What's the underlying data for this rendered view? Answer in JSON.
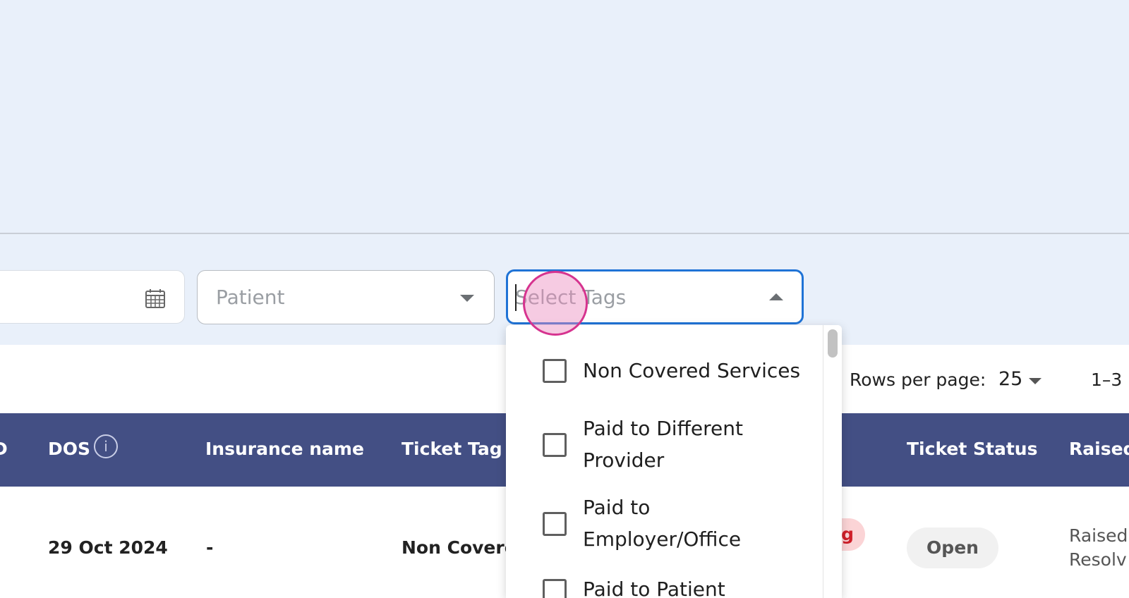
{
  "filters": {
    "patient_placeholder": "Patient",
    "tags_placeholder": "Select Tags",
    "date_icon": "calendar-icon"
  },
  "tags_dropdown": {
    "options": [
      {
        "label": "Non Covered Services",
        "checked": false
      },
      {
        "label": "Paid to Different Provider",
        "checked": false
      },
      {
        "label": "Paid to Employer/Office",
        "checked": false
      },
      {
        "label": "Paid to Patient",
        "checked": false
      }
    ]
  },
  "pagination": {
    "rows_per_page_label": "Rows per page:",
    "rows_per_page_value": "25",
    "range_text": "1–3"
  },
  "table": {
    "headers": {
      "partial_left": "D",
      "dos": "DOS",
      "insurance_name": "Insurance name",
      "ticket_tag": "Ticket Tag",
      "ticket_status": "Ticket Status",
      "raised": "Raised"
    },
    "rows": [
      {
        "dos": "29 Oct 2024",
        "insurance_name": "-",
        "ticket_tag": "Non Covere",
        "tag_badge": "g",
        "ticket_status": "Open",
        "raised_line1": "Raised",
        "raised_line2": "Resolv"
      }
    ]
  },
  "colors": {
    "header_bg": "#434f84",
    "focus_border": "#1f73d6",
    "page_bg": "#e9f0fa",
    "click_marker": "#d6338f"
  }
}
